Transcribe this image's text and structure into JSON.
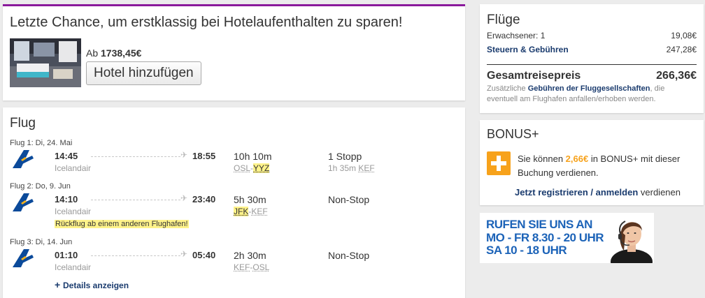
{
  "hotel": {
    "title": "Letzte Chance, um erstklassig bei Hotelaufenthalten zu sparen!",
    "price_prefix": "Ab",
    "price": "1738,45€",
    "add_button": "Hotel hinzufügen"
  },
  "flights": {
    "title": "Flug",
    "details_link": "Details anzeigen",
    "legs": [
      {
        "label": "Flug 1: Di, 24. Mai",
        "airline": "Icelandair",
        "dep_time": "14:45",
        "arr_time": "18:55",
        "duration": "10h 10m",
        "route_from": "OSL",
        "route_to": "YYZ",
        "stops": "1 Stopp",
        "stop_duration": "1h 35m",
        "stop_airport": "KEF"
      },
      {
        "label": "Flug 2: Do, 9. Jun",
        "airline": "Icelandair",
        "dep_time": "14:10",
        "arr_time": "23:40",
        "duration": "5h 30m",
        "route_from": "JFK",
        "route_to": "KEF",
        "stops": "Non-Stop",
        "warning": "Rückflug ab einem anderen Flughafen!"
      },
      {
        "label": "Flug 3: Di, 14. Jun",
        "airline": "Icelandair",
        "dep_time": "01:10",
        "arr_time": "05:40",
        "duration": "2h 30m",
        "route_from": "KEF",
        "route_to": "OSL",
        "stops": "Non-Stop"
      }
    ]
  },
  "price": {
    "title": "Flüge",
    "adults_label": "Erwachsener: 1",
    "adults_value": "19,08€",
    "taxes_label": "Steuern & Gebühren",
    "taxes_value": "247,28€",
    "total_label": "Gesamtreisepreis",
    "total_value": "266,36€",
    "note_before": "Zusätzliche ",
    "note_link": "Gebühren der Fluggesellschaften",
    "note_after": ", die eventuell am Flughafen anfallen/erhoben werden."
  },
  "bonus": {
    "title": "BONUS+",
    "text_before": "Sie können ",
    "amount": "2,66€",
    "text_after": " in BONUS+ mit dieser Buchung verdienen.",
    "register_link": "Jetzt registrieren / anmelden",
    "register_after": " verdienen"
  },
  "call": {
    "line1": "RUFEN SIE UNS AN",
    "line2": "MO - FR 8.30 - 20 UHR",
    "line3": "SA 10 - 18 UHR"
  },
  "colors": {
    "accent_purple": "#8a1a9b",
    "link_blue": "#1a3b6e",
    "bonus_orange": "#f7a21b",
    "banner_blue": "#1c63b8",
    "highlight_yellow": "#fff38a"
  }
}
